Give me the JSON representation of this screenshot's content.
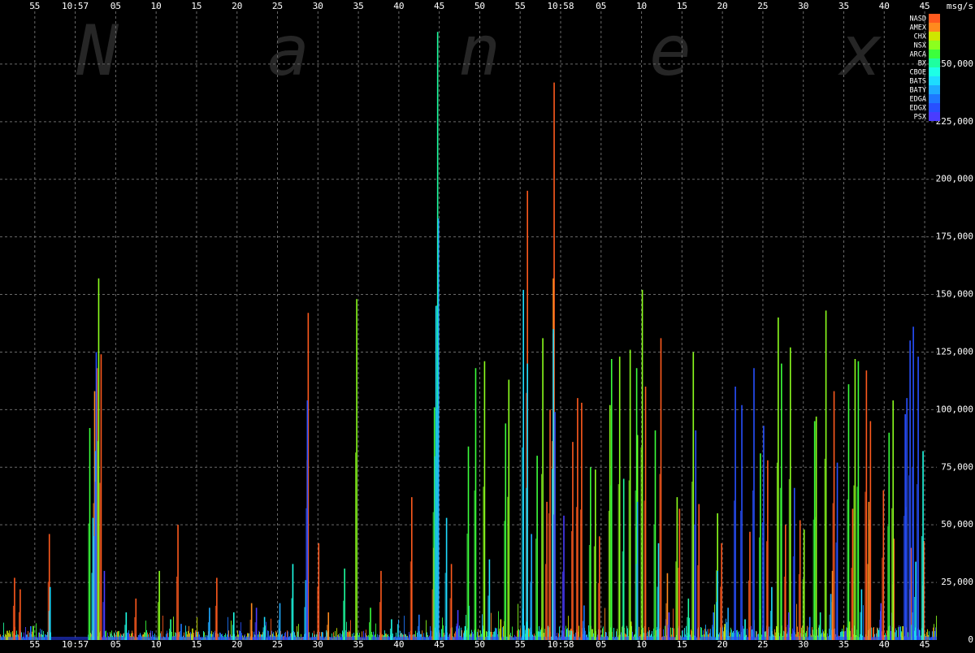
{
  "chart_data": {
    "type": "line",
    "watermark": "Nanex",
    "ylabel": "msg/s",
    "ylim": [
      0,
      275000
    ],
    "grid": true,
    "legend_position": "top-right",
    "y_ticks": [
      0,
      25000,
      50000,
      75000,
      100000,
      125000,
      150000,
      175000,
      200000,
      225000,
      250000
    ],
    "y_tick_labels": [
      "0",
      "25,000",
      "50,000",
      "75,000",
      "100,000",
      "125,000",
      "150,000",
      "175,000",
      "200,000",
      "225,000",
      "250,000"
    ],
    "x_ticks": [
      {
        "t": -5,
        "label": "55"
      },
      {
        "t": 0,
        "label": "10:57"
      },
      {
        "t": 5,
        "label": "05"
      },
      {
        "t": 10,
        "label": "10"
      },
      {
        "t": 15,
        "label": "15"
      },
      {
        "t": 20,
        "label": "20"
      },
      {
        "t": 25,
        "label": "25"
      },
      {
        "t": 30,
        "label": "30"
      },
      {
        "t": 35,
        "label": "35"
      },
      {
        "t": 40,
        "label": "40"
      },
      {
        "t": 45,
        "label": "45"
      },
      {
        "t": 50,
        "label": "50"
      },
      {
        "t": 55,
        "label": "55"
      },
      {
        "t": 60,
        "label": "10:58"
      },
      {
        "t": 65,
        "label": "05"
      },
      {
        "t": 70,
        "label": "10"
      },
      {
        "t": 75,
        "label": "15"
      },
      {
        "t": 80,
        "label": "20"
      },
      {
        "t": 85,
        "label": "25"
      },
      {
        "t": 90,
        "label": "30"
      },
      {
        "t": 95,
        "label": "35"
      },
      {
        "t": 100,
        "label": "40"
      },
      {
        "t": 105,
        "label": "45"
      }
    ],
    "xlim": [
      -9.3,
      106.5
    ],
    "series": [
      {
        "name": "NASD",
        "color": "#ff5a1e",
        "values": [
          [
            -7.5,
            27000
          ],
          [
            -6.8,
            22000
          ],
          [
            -3.2,
            46000
          ],
          [
            2.7,
            118000
          ],
          [
            3.2,
            124000
          ],
          [
            7.5,
            18000
          ],
          [
            12.7,
            50000
          ],
          [
            17.5,
            27000
          ],
          [
            28.8,
            142000
          ],
          [
            30.1,
            42000
          ],
          [
            37.8,
            30000
          ],
          [
            41.6,
            62000
          ],
          [
            44.3,
            40000
          ],
          [
            46.5,
            33000
          ],
          [
            55.9,
            195000
          ],
          [
            58.3,
            60000
          ],
          [
            58.7,
            100000
          ],
          [
            59.2,
            242000
          ],
          [
            61.5,
            86000
          ],
          [
            62.1,
            105000
          ],
          [
            62.6,
            103000
          ],
          [
            64.8,
            45000
          ],
          [
            70.5,
            110000
          ],
          [
            72.4,
            131000
          ],
          [
            74.7,
            57000
          ],
          [
            77.1,
            59000
          ],
          [
            79.9,
            42000
          ],
          [
            83.4,
            47000
          ],
          [
            85.6,
            78000
          ],
          [
            87.8,
            50000
          ],
          [
            89.6,
            52000
          ],
          [
            93.8,
            108000
          ],
          [
            96.1,
            57000
          ],
          [
            97.8,
            117000
          ],
          [
            98.3,
            95000
          ],
          [
            99.9,
            65000
          ],
          [
            101.2,
            44000
          ],
          [
            103.3,
            40000
          ],
          [
            104.9,
            43000
          ]
        ]
      },
      {
        "name": "AMEX",
        "color": "#ff8a1e",
        "values": [
          [
            2.4,
            108000
          ],
          [
            21.8,
            16000
          ],
          [
            31.3,
            12000
          ],
          [
            59.1,
            157000
          ],
          [
            73.2,
            29000
          ],
          [
            93.6,
            30000
          ],
          [
            98.1,
            60000
          ]
        ]
      },
      {
        "name": "CHX",
        "color": "#cfe600",
        "values": [
          [
            -8.4,
            4000
          ],
          [
            14.5,
            5000
          ],
          [
            52.6,
            9000
          ],
          [
            68.7,
            8000
          ],
          [
            80.3,
            7000
          ],
          [
            86.7,
            6000
          ],
          [
            95.7,
            8000
          ],
          [
            102.3,
            6000
          ]
        ]
      },
      {
        "name": "NSX",
        "color": "#8cff1e",
        "values": [
          [
            2.9,
            157000
          ],
          [
            10.4,
            30000
          ],
          [
            34.8,
            148000
          ],
          [
            50.6,
            121000
          ],
          [
            53.6,
            113000
          ],
          [
            57.8,
            131000
          ],
          [
            64.3,
            74000
          ],
          [
            66.1,
            102000
          ],
          [
            67.3,
            123000
          ],
          [
            68.6,
            126000
          ],
          [
            69.5,
            89000
          ],
          [
            70.1,
            152000
          ],
          [
            74.4,
            62000
          ],
          [
            76.4,
            125000
          ],
          [
            79.4,
            55000
          ],
          [
            86.9,
            140000
          ],
          [
            88.4,
            127000
          ],
          [
            90.1,
            48000
          ],
          [
            91.6,
            97000
          ],
          [
            92.8,
            143000
          ],
          [
            96.4,
            122000
          ],
          [
            101.1,
            104000
          ]
        ]
      },
      {
        "name": "ARCA",
        "color": "#3cff3c",
        "values": [
          [
            1.8,
            92000
          ],
          [
            36.5,
            14000
          ],
          [
            44.4,
            101000
          ],
          [
            48.6,
            84000
          ],
          [
            49.5,
            118000
          ],
          [
            53.2,
            94000
          ],
          [
            57.1,
            80000
          ],
          [
            63.7,
            75000
          ],
          [
            66.3,
            122000
          ],
          [
            69.4,
            118000
          ],
          [
            71.7,
            91000
          ],
          [
            84.7,
            81000
          ],
          [
            87.3,
            120000
          ],
          [
            91.4,
            95000
          ],
          [
            95.6,
            111000
          ],
          [
            96.8,
            121000
          ],
          [
            100.6,
            90000
          ]
        ]
      },
      {
        "name": "BX",
        "color": "#1effa0",
        "values": [
          [
            44.8,
            264000
          ],
          [
            11.8,
            9000
          ],
          [
            33.3,
            31000
          ],
          [
            55.8,
            8000
          ],
          [
            67.8,
            70000
          ],
          [
            75.8,
            18000
          ],
          [
            92.1,
            12000
          ],
          [
            103.5,
            12000
          ]
        ]
      },
      {
        "name": "CBOE",
        "color": "#1effe6",
        "values": [
          [
            6.3,
            12000
          ],
          [
            19.6,
            12000
          ],
          [
            26.9,
            33000
          ],
          [
            39.1,
            9000
          ],
          [
            48.2,
            6000
          ],
          [
            61.3,
            4000
          ],
          [
            82.8,
            9000
          ],
          [
            104.8,
            82000
          ]
        ]
      },
      {
        "name": "BATS",
        "color": "#1edcff",
        "values": [
          [
            -3.1,
            23000
          ],
          [
            2.2,
            53000
          ],
          [
            23.4,
            10000
          ],
          [
            28.5,
            26000
          ],
          [
            44.6,
            145000
          ],
          [
            45.9,
            53000
          ],
          [
            51.2,
            35000
          ],
          [
            55.4,
            152000
          ],
          [
            55.9,
            120000
          ],
          [
            59.1,
            135000
          ],
          [
            72.1,
            42000
          ],
          [
            79.4,
            30000
          ],
          [
            86.1,
            23000
          ],
          [
            97.2,
            22000
          ],
          [
            103.9,
            34000
          ]
        ]
      },
      {
        "name": "BATY",
        "color": "#1eaaff",
        "values": [
          [
            2.5,
            82000
          ],
          [
            16.6,
            14000
          ],
          [
            25.3,
            16000
          ],
          [
            44.9,
            183000
          ],
          [
            56.4,
            46000
          ],
          [
            69.5,
            60000
          ],
          [
            80.7,
            14000
          ],
          [
            93.4,
            20000
          ]
        ]
      },
      {
        "name": "EDGA",
        "color": "#1e78ff",
        "values": [
          [
            -5.5,
            6000
          ],
          [
            13.1,
            7000
          ],
          [
            42.5,
            11000
          ],
          [
            62.9,
            15000
          ],
          [
            78.9,
            12000
          ],
          [
            90.8,
            10000
          ]
        ]
      },
      {
        "name": "EDGX",
        "color": "#2850ff",
        "values": [
          [
            2.6,
            125000
          ],
          [
            28.7,
            104000
          ],
          [
            59.3,
            99000
          ],
          [
            76.7,
            91000
          ],
          [
            81.6,
            110000
          ],
          [
            82.4,
            102000
          ],
          [
            83.9,
            118000
          ],
          [
            85.1,
            93000
          ],
          [
            88.9,
            66000
          ],
          [
            94.2,
            77000
          ],
          [
            102.6,
            98000
          ],
          [
            103.2,
            130000
          ],
          [
            103.6,
            136000
          ],
          [
            104.2,
            123000
          ],
          [
            102.8,
            105000
          ]
        ]
      },
      {
        "name": "PSX",
        "color": "#4a3cff",
        "values": [
          [
            3.6,
            30000
          ],
          [
            22.4,
            14000
          ],
          [
            47.3,
            13000
          ],
          [
            60.4,
            54000
          ],
          [
            73.4,
            12000
          ],
          [
            88.2,
            12000
          ],
          [
            99.6,
            16000
          ]
        ]
      }
    ],
    "baseline_noise": true
  }
}
